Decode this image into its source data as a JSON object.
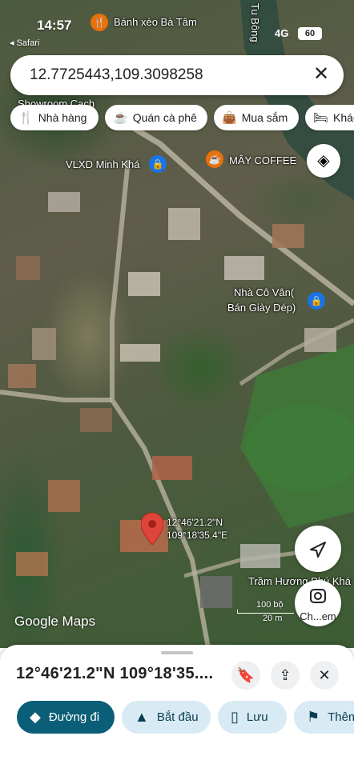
{
  "status_bar": {
    "time": "14:57",
    "back_app": "◂ Safari",
    "network": "4G",
    "battery": "60"
  },
  "search": {
    "value": "12.7725443,109.3098258"
  },
  "chips": [
    {
      "label": "Nhà hàng",
      "icon": "fork-knife-icon"
    },
    {
      "label": "Quán cà phê",
      "icon": "coffee-icon"
    },
    {
      "label": "Mua sắm",
      "icon": "shopping-bag-icon"
    },
    {
      "label": "Khác",
      "icon": "bed-icon"
    }
  ],
  "map_labels": {
    "top_place": "Bánh xèo Bà Tâm",
    "river": "Tu Bông",
    "showroom": "Showroom Cach",
    "vlxd": "VLXD Minh Khá",
    "coffee": "MÂY COFFEE",
    "shop_line1": "Nhà Cô Vân(",
    "shop_line2": "Bán Giày Dép)",
    "tram": "Trầm Hương Phú Khá"
  },
  "dropped_pin": {
    "lat": "12°46'21.2\"N",
    "lng": "109°18'35.4\"E"
  },
  "attribution": "Google Maps",
  "scale": {
    "imperial": "100 bộ",
    "metric": "20 m"
  },
  "lens_label": "Ch...em",
  "sheet": {
    "title": "12°46'21.2\"N 109°18'35....",
    "actions": [
      {
        "label": "Đường đi",
        "icon": "directions-icon"
      },
      {
        "label": "Bắt đầu",
        "icon": "navigation-arrow-icon"
      },
      {
        "label": "Lưu",
        "icon": "bookmark-icon"
      },
      {
        "label": "Thêm",
        "icon": "flag-icon"
      }
    ]
  },
  "colors": {
    "accent": "#0b5e77",
    "pin": "#e0453b",
    "chip_bg": "#ffffff",
    "action_bg": "#d8eaf3"
  }
}
